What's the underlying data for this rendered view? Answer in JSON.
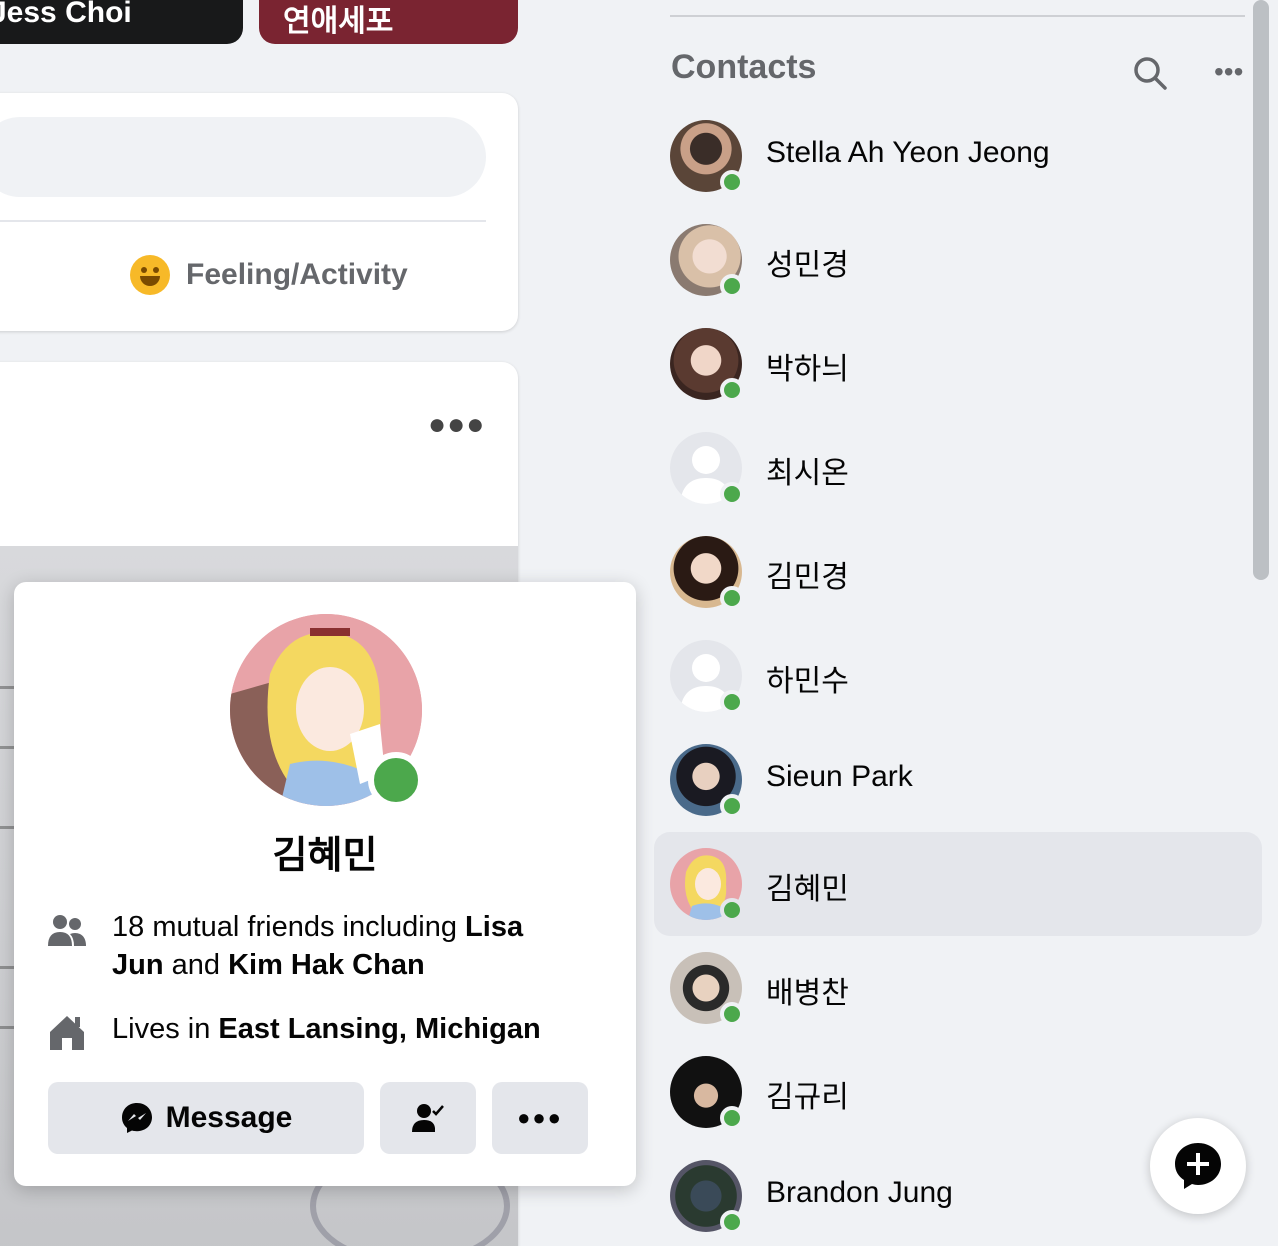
{
  "stories": [
    {
      "label": "Jess Choi"
    },
    {
      "label": "연애세포"
    }
  ],
  "composer": {
    "feeling_label": "Feeling/Activity",
    "feeling_icon": "smiley-icon"
  },
  "post": {
    "more_icon": "more-horizontal-icon"
  },
  "hovercard": {
    "name": "김혜민",
    "mutual_prefix": "18 mutual friends including ",
    "mutual_friend_1": "Lisa Jun",
    "mutual_joiner": " and ",
    "mutual_friend_2": "Kim Hak Chan",
    "lives_prefix": "Lives in ",
    "lives_place": "East Lansing, Michigan",
    "message_label": "Message",
    "online": true
  },
  "contacts": {
    "title": "Contacts",
    "items": [
      {
        "name": "Stella Ah Yeon Jeong",
        "online": true
      },
      {
        "name": "성민경",
        "online": true
      },
      {
        "name": "박하늬",
        "online": true
      },
      {
        "name": "최시온",
        "online": true
      },
      {
        "name": "김민경",
        "online": true
      },
      {
        "name": "하민수",
        "online": true
      },
      {
        "name": "Sieun Park",
        "online": true
      },
      {
        "name": "김혜민",
        "online": true,
        "active": true
      },
      {
        "name": "배병찬",
        "online": true
      },
      {
        "name": "김규리",
        "online": true
      },
      {
        "name": "Brandon Jung",
        "online": true
      }
    ]
  },
  "colors": {
    "online_green": "#4ca84c",
    "background": "#f0f2f5",
    "button_grey": "#e4e6eb"
  }
}
